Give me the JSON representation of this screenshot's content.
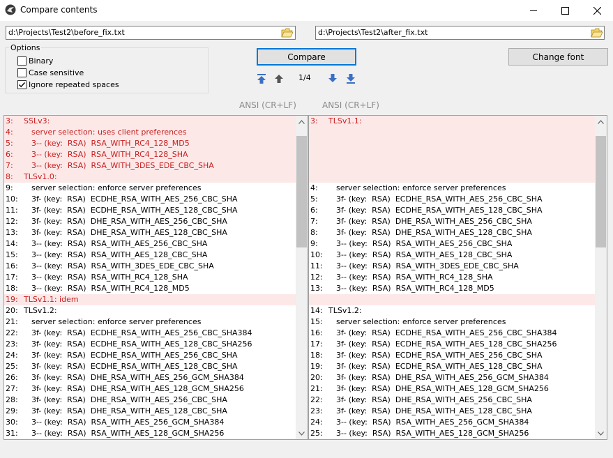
{
  "window": {
    "title": "Compare contents"
  },
  "left_path": "d:\\Projects\\Test2\\before_fix.txt",
  "right_path": "d:\\Projects\\Test2\\after_fix.txt",
  "options": {
    "label": "Options",
    "binary": {
      "label": "Binary",
      "checked": false
    },
    "case_sensitive": {
      "label": "Case sensitive",
      "checked": false
    },
    "ignore_spaces": {
      "label": "Ignore repeated spaces",
      "checked": true
    }
  },
  "compare_label": "Compare",
  "change_font_label": "Change font",
  "counter": "1/4",
  "left_encoding": "ANSI (CR+LF)",
  "right_encoding": "ANSI (CR+LF)",
  "left_lines": [
    {
      "n": "3:",
      "t": "SSLv3:",
      "diff": true,
      "indent": 0
    },
    {
      "n": "4:",
      "t": "server selection: uses client preferences",
      "diff": true,
      "indent": 1
    },
    {
      "n": "5:",
      "t": "3-- (key:  RSA)  RSA_WITH_RC4_128_MD5",
      "diff": true,
      "indent": 1
    },
    {
      "n": "6:",
      "t": "3-- (key:  RSA)  RSA_WITH_RC4_128_SHA",
      "diff": true,
      "indent": 1
    },
    {
      "n": "7:",
      "t": "3-- (key:  RSA)  RSA_WITH_3DES_EDE_CBC_SHA",
      "diff": true,
      "indent": 1
    },
    {
      "n": "8:",
      "t": "TLSv1.0:",
      "diff": true,
      "indent": 0
    },
    {
      "n": "9:",
      "t": "server selection: enforce server preferences",
      "diff": false,
      "indent": 1
    },
    {
      "n": "10:",
      "t": "3f- (key:  RSA)  ECDHE_RSA_WITH_AES_256_CBC_SHA",
      "diff": false,
      "indent": 1
    },
    {
      "n": "11:",
      "t": "3f- (key:  RSA)  ECDHE_RSA_WITH_AES_128_CBC_SHA",
      "diff": false,
      "indent": 1
    },
    {
      "n": "12:",
      "t": "3f- (key:  RSA)  DHE_RSA_WITH_AES_256_CBC_SHA",
      "diff": false,
      "indent": 1
    },
    {
      "n": "13:",
      "t": "3f- (key:  RSA)  DHE_RSA_WITH_AES_128_CBC_SHA",
      "diff": false,
      "indent": 1
    },
    {
      "n": "14:",
      "t": "3-- (key:  RSA)  RSA_WITH_AES_256_CBC_SHA",
      "diff": false,
      "indent": 1
    },
    {
      "n": "15:",
      "t": "3-- (key:  RSA)  RSA_WITH_AES_128_CBC_SHA",
      "diff": false,
      "indent": 1
    },
    {
      "n": "16:",
      "t": "3-- (key:  RSA)  RSA_WITH_3DES_EDE_CBC_SHA",
      "diff": false,
      "indent": 1
    },
    {
      "n": "17:",
      "t": "3-- (key:  RSA)  RSA_WITH_RC4_128_SHA",
      "diff": false,
      "indent": 1
    },
    {
      "n": "18:",
      "t": "3-- (key:  RSA)  RSA_WITH_RC4_128_MD5",
      "diff": false,
      "indent": 1
    },
    {
      "n": "19:",
      "t": "TLSv1.1: idem",
      "diff": true,
      "indent": 0
    },
    {
      "n": "20:",
      "t": "TLSv1.2:",
      "diff": false,
      "indent": 0
    },
    {
      "n": "21:",
      "t": "server selection: enforce server preferences",
      "diff": false,
      "indent": 1
    },
    {
      "n": "22:",
      "t": "3f- (key:  RSA)  ECDHE_RSA_WITH_AES_256_CBC_SHA384",
      "diff": false,
      "indent": 1
    },
    {
      "n": "23:",
      "t": "3f- (key:  RSA)  ECDHE_RSA_WITH_AES_128_CBC_SHA256",
      "diff": false,
      "indent": 1
    },
    {
      "n": "24:",
      "t": "3f- (key:  RSA)  ECDHE_RSA_WITH_AES_256_CBC_SHA",
      "diff": false,
      "indent": 1
    },
    {
      "n": "25:",
      "t": "3f- (key:  RSA)  ECDHE_RSA_WITH_AES_128_CBC_SHA",
      "diff": false,
      "indent": 1
    },
    {
      "n": "26:",
      "t": "3f- (key:  RSA)  DHE_RSA_WITH_AES_256_GCM_SHA384",
      "diff": false,
      "indent": 1
    },
    {
      "n": "27:",
      "t": "3f- (key:  RSA)  DHE_RSA_WITH_AES_128_GCM_SHA256",
      "diff": false,
      "indent": 1
    },
    {
      "n": "28:",
      "t": "3f- (key:  RSA)  DHE_RSA_WITH_AES_256_CBC_SHA",
      "diff": false,
      "indent": 1
    },
    {
      "n": "29:",
      "t": "3f- (key:  RSA)  DHE_RSA_WITH_AES_128_CBC_SHA",
      "diff": false,
      "indent": 1
    },
    {
      "n": "30:",
      "t": "3-- (key:  RSA)  RSA_WITH_AES_256_GCM_SHA384",
      "diff": false,
      "indent": 1
    },
    {
      "n": "31:",
      "t": "3-- (key:  RSA)  RSA_WITH_AES_128_GCM_SHA256",
      "diff": false,
      "indent": 1
    }
  ],
  "right_lines": [
    {
      "n": "3:",
      "t": "TLSv1.1:",
      "diff": true,
      "indent": 0
    },
    {
      "n": "",
      "t": "",
      "diff": true,
      "indent": 0
    },
    {
      "n": "",
      "t": "",
      "diff": true,
      "indent": 0
    },
    {
      "n": "",
      "t": "",
      "diff": true,
      "indent": 0
    },
    {
      "n": "",
      "t": "",
      "diff": true,
      "indent": 0
    },
    {
      "n": "",
      "t": "",
      "diff": true,
      "indent": 0
    },
    {
      "n": "4:",
      "t": "server selection: enforce server preferences",
      "diff": false,
      "indent": 1
    },
    {
      "n": "5:",
      "t": "3f- (key:  RSA)  ECDHE_RSA_WITH_AES_256_CBC_SHA",
      "diff": false,
      "indent": 1
    },
    {
      "n": "6:",
      "t": "3f- (key:  RSA)  ECDHE_RSA_WITH_AES_128_CBC_SHA",
      "diff": false,
      "indent": 1
    },
    {
      "n": "7:",
      "t": "3f- (key:  RSA)  DHE_RSA_WITH_AES_256_CBC_SHA",
      "diff": false,
      "indent": 1
    },
    {
      "n": "8:",
      "t": "3f- (key:  RSA)  DHE_RSA_WITH_AES_128_CBC_SHA",
      "diff": false,
      "indent": 1
    },
    {
      "n": "9:",
      "t": "3-- (key:  RSA)  RSA_WITH_AES_256_CBC_SHA",
      "diff": false,
      "indent": 1
    },
    {
      "n": "10:",
      "t": "3-- (key:  RSA)  RSA_WITH_AES_128_CBC_SHA",
      "diff": false,
      "indent": 1
    },
    {
      "n": "11:",
      "t": "3-- (key:  RSA)  RSA_WITH_3DES_EDE_CBC_SHA",
      "diff": false,
      "indent": 1
    },
    {
      "n": "12:",
      "t": "3-- (key:  RSA)  RSA_WITH_RC4_128_SHA",
      "diff": false,
      "indent": 1
    },
    {
      "n": "13:",
      "t": "3-- (key:  RSA)  RSA_WITH_RC4_128_MD5",
      "diff": false,
      "indent": 1
    },
    {
      "n": "",
      "t": "",
      "diff": true,
      "indent": 0
    },
    {
      "n": "14:",
      "t": "TLSv1.2:",
      "diff": false,
      "indent": 0
    },
    {
      "n": "15:",
      "t": "server selection: enforce server preferences",
      "diff": false,
      "indent": 1
    },
    {
      "n": "16:",
      "t": "3f- (key:  RSA)  ECDHE_RSA_WITH_AES_256_CBC_SHA384",
      "diff": false,
      "indent": 1
    },
    {
      "n": "17:",
      "t": "3f- (key:  RSA)  ECDHE_RSA_WITH_AES_128_CBC_SHA256",
      "diff": false,
      "indent": 1
    },
    {
      "n": "18:",
      "t": "3f- (key:  RSA)  ECDHE_RSA_WITH_AES_256_CBC_SHA",
      "diff": false,
      "indent": 1
    },
    {
      "n": "19:",
      "t": "3f- (key:  RSA)  ECDHE_RSA_WITH_AES_128_CBC_SHA",
      "diff": false,
      "indent": 1
    },
    {
      "n": "20:",
      "t": "3f- (key:  RSA)  DHE_RSA_WITH_AES_256_GCM_SHA384",
      "diff": false,
      "indent": 1
    },
    {
      "n": "21:",
      "t": "3f- (key:  RSA)  DHE_RSA_WITH_AES_128_GCM_SHA256",
      "diff": false,
      "indent": 1
    },
    {
      "n": "22:",
      "t": "3f- (key:  RSA)  DHE_RSA_WITH_AES_256_CBC_SHA",
      "diff": false,
      "indent": 1
    },
    {
      "n": "23:",
      "t": "3f- (key:  RSA)  DHE_RSA_WITH_AES_128_CBC_SHA",
      "diff": false,
      "indent": 1
    },
    {
      "n": "24:",
      "t": "3-- (key:  RSA)  RSA_WITH_AES_256_GCM_SHA384",
      "diff": false,
      "indent": 1
    },
    {
      "n": "25:",
      "t": "3-- (key:  RSA)  RSA_WITH_AES_128_GCM_SHA256",
      "diff": false,
      "indent": 1
    }
  ],
  "colors": {
    "diff_bg": "#fde8e8",
    "diff_text": "#c81e1e",
    "nav_arrow": "#3b6fc4",
    "accent": "#0078d7"
  },
  "icons": {
    "app": "app-icon",
    "minimize": "minimize-icon",
    "maximize": "maximize-icon",
    "close": "close-icon",
    "folder": "folder-open-icon",
    "first": "first-diff-icon",
    "prev": "prev-diff-icon",
    "next": "next-diff-icon",
    "last": "last-diff-icon"
  }
}
